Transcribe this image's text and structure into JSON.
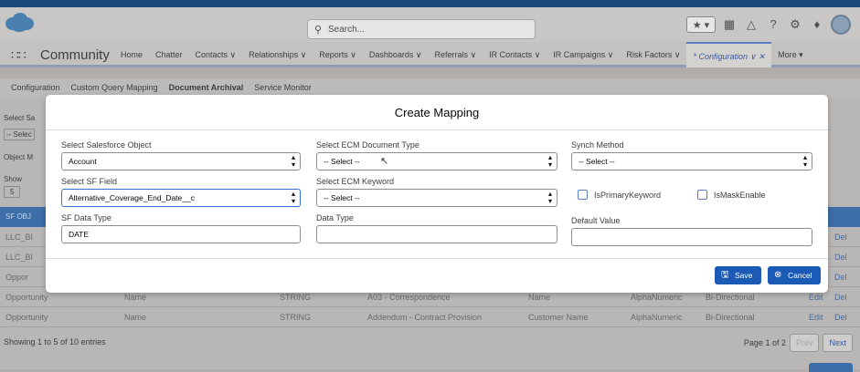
{
  "header": {
    "search_placeholder": "Search...",
    "star_label": "★ ▾"
  },
  "nav": {
    "app_name": "Community",
    "items": [
      {
        "label": "Home"
      },
      {
        "label": "Chatter"
      },
      {
        "label": "Contacts ∨"
      },
      {
        "label": "Relationships ∨"
      },
      {
        "label": "Reports ∨"
      },
      {
        "label": "Dashboards ∨"
      },
      {
        "label": "Referrals ∨"
      },
      {
        "label": "IR Contacts ∨"
      },
      {
        "label": "IR Campaigns ∨"
      },
      {
        "label": "Risk Factors ∨"
      },
      {
        "label": "* Configuration ∨ ✕"
      },
      {
        "label": "More ▾"
      }
    ]
  },
  "subtabs": [
    "Configuration",
    "Custom Query Mapping",
    "Document Archival",
    "Service Monitor"
  ],
  "background": {
    "left_labels": [
      "Select Sa",
      "-- Selec",
      "Object M",
      "Show",
      "5",
      "SF OBJ"
    ],
    "rows": [
      {
        "obj": "LLC_BI",
        "del": "Del"
      },
      {
        "obj": "LLC_BI",
        "del": "Del"
      },
      {
        "obj": "Oppor",
        "del": "Del"
      },
      {
        "obj": "Opportunity",
        "field": "Name",
        "type": "STRING",
        "doc": "A03 - Correspondence",
        "kw": "Name",
        "fmt": "AlphaNumeric",
        "sync": "Bi-Directional",
        "edit": "Edit",
        "del": "Del"
      },
      {
        "obj": "Opportunity",
        "field": "Name",
        "type": "STRING",
        "doc": "Addendum - Contract Provision",
        "kw": "Customer Name",
        "fmt": "AlphaNumeric",
        "sync": "Bi-Directional",
        "edit": "Edit",
        "del": "Del"
      }
    ],
    "showing": "Showing 1 to 5 of 10 entries",
    "page": "Page 1 of 2",
    "prev": "Prev",
    "next": "Next"
  },
  "modal": {
    "title": "Create Mapping",
    "sf_object": {
      "label": "Select Salesforce Object",
      "value": "Account"
    },
    "ecm_doc_type": {
      "label": "Select ECM Document Type",
      "value": "-- Select --"
    },
    "synch_method": {
      "label": "Synch Method",
      "value": "-- Select --"
    },
    "sf_field": {
      "label": "Select SF Field",
      "value": "Alternative_Coverage_End_Date__c"
    },
    "ecm_keyword": {
      "label": "Select ECM Keyword",
      "value": "-- Select --"
    },
    "is_primary": "IsPrimaryKeyword",
    "is_mask": "IsMaskEnable",
    "sf_data_type": {
      "label": "SF Data Type",
      "value": "DATE"
    },
    "data_type": {
      "label": "Data Type",
      "value": ""
    },
    "default_value": {
      "label": "Default Value",
      "value": ""
    },
    "save": "Save",
    "cancel": "Cancel"
  }
}
